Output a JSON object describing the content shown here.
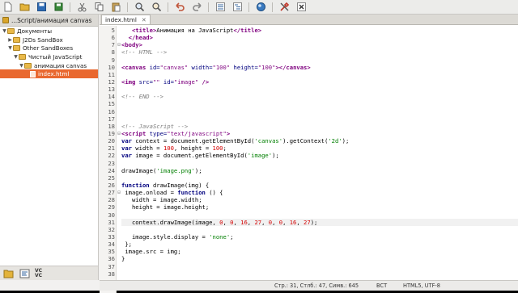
{
  "toolbar": {
    "buttons": [
      {
        "icon": "new-file-icon",
        "color": "#f0f0f0"
      },
      {
        "icon": "open-folder-icon",
        "color": "#e3b33a"
      },
      {
        "icon": "save-icon",
        "color": "#2e6bb5"
      },
      {
        "icon": "save-all-icon",
        "color": "#3a8a3a"
      },
      {
        "icon": "cut-icon",
        "color": "#666666"
      },
      {
        "icon": "copy-icon",
        "color": "#666666"
      },
      {
        "icon": "paste-icon",
        "color": "#c7a15a"
      },
      {
        "icon": "find-icon",
        "color": "#555555"
      },
      {
        "icon": "replace-icon",
        "color": "#555555"
      },
      {
        "icon": "undo-icon",
        "color": "#c0553a"
      },
      {
        "icon": "redo-icon",
        "color": "#888888"
      },
      {
        "icon": "list-icon",
        "color": "#3a6aa0"
      },
      {
        "icon": "outline-icon",
        "color": "#3a6aa0"
      },
      {
        "icon": "browser-icon",
        "color": "#3a7ac0"
      },
      {
        "icon": "tools-icon",
        "color": "#c0392b"
      },
      {
        "icon": "close-icon",
        "color": "#333333"
      }
    ]
  },
  "project": {
    "tab_label": "...Script/анимация canvas",
    "tree": [
      {
        "label": "Документы",
        "kind": "folder",
        "depth": 0,
        "expanded": true
      },
      {
        "label": "J2Ds SandBox",
        "kind": "folder",
        "depth": 1,
        "expanded": false
      },
      {
        "label": "Other SandBoxes",
        "kind": "folder",
        "depth": 1,
        "expanded": true
      },
      {
        "label": "Чистый JavaScript",
        "kind": "folder",
        "depth": 2,
        "expanded": true
      },
      {
        "label": "анимация canvas",
        "kind": "folder",
        "depth": 3,
        "expanded": true
      },
      {
        "label": "index.html",
        "kind": "file",
        "depth": 4,
        "selected": true
      }
    ]
  },
  "bottom_tools": [
    {
      "icon": "file-browser-icon"
    },
    {
      "icon": "symbols-icon"
    },
    {
      "icon": "version-control-icon",
      "label": "VC VC"
    }
  ],
  "editor": {
    "tab_label": "index.html",
    "tab_close": "✕",
    "current_line": 31,
    "lines": [
      {
        "n": "5",
        "fold": "",
        "tokens": [
          [
            "p",
            "   "
          ],
          [
            "t",
            "<title>"
          ],
          [
            "p",
            "Анимация на JavaScript"
          ],
          [
            "t",
            "</title>"
          ]
        ]
      },
      {
        "n": "6",
        "fold": "",
        "tokens": [
          [
            "p",
            "  "
          ],
          [
            "t",
            "</head>"
          ]
        ]
      },
      {
        "n": "7",
        "fold": "⊟",
        "tokens": [
          [
            "t",
            "<body>"
          ]
        ]
      },
      {
        "n": "8",
        "fold": "",
        "tokens": [
          [
            "c",
            "<!-- HTML -->"
          ]
        ]
      },
      {
        "n": "9",
        "fold": "",
        "tokens": []
      },
      {
        "n": "10",
        "fold": "",
        "tokens": [
          [
            "t",
            "<canvas "
          ],
          [
            "a",
            "id="
          ],
          [
            "s",
            "\"canvas\""
          ],
          [
            "a",
            " width="
          ],
          [
            "s",
            "\"100\""
          ],
          [
            "a",
            " height="
          ],
          [
            "s",
            "\"100\""
          ],
          [
            "t",
            "></canvas>"
          ]
        ]
      },
      {
        "n": "11",
        "fold": "",
        "tokens": []
      },
      {
        "n": "12",
        "fold": "",
        "tokens": [
          [
            "t",
            "<img "
          ],
          [
            "a",
            "src="
          ],
          [
            "s",
            "\"\""
          ],
          [
            "a",
            " id="
          ],
          [
            "s",
            "\"image\""
          ],
          [
            "t",
            " />"
          ]
        ]
      },
      {
        "n": "13",
        "fold": "",
        "tokens": []
      },
      {
        "n": "14",
        "fold": "",
        "tokens": [
          [
            "c",
            "<!-- END -->"
          ]
        ]
      },
      {
        "n": "15",
        "fold": "",
        "tokens": []
      },
      {
        "n": "16",
        "fold": "",
        "tokens": []
      },
      {
        "n": "17",
        "fold": "",
        "tokens": []
      },
      {
        "n": "18",
        "fold": "",
        "tokens": [
          [
            "c",
            "<!-- JavaScript -->"
          ]
        ]
      },
      {
        "n": "19",
        "fold": "⊟",
        "tokens": [
          [
            "t",
            "<script "
          ],
          [
            "a",
            "type="
          ],
          [
            "s",
            "\"text/javascript\""
          ],
          [
            "t",
            ">"
          ]
        ]
      },
      {
        "n": "20",
        "fold": "",
        "tokens": [
          [
            "k",
            "var"
          ],
          [
            "p",
            " context = document.getElementById("
          ],
          [
            "sq",
            "'canvas'"
          ],
          [
            "p",
            ").getContext("
          ],
          [
            "sq",
            "'2d'"
          ],
          [
            "p",
            ");"
          ]
        ]
      },
      {
        "n": "21",
        "fold": "",
        "tokens": [
          [
            "k",
            "var"
          ],
          [
            "p",
            " width = "
          ],
          [
            "n",
            "100"
          ],
          [
            "p",
            ", height = "
          ],
          [
            "n",
            "100"
          ],
          [
            "p",
            ";"
          ]
        ]
      },
      {
        "n": "22",
        "fold": "",
        "tokens": [
          [
            "k",
            "var"
          ],
          [
            "p",
            " image = document.getElementById("
          ],
          [
            "sq",
            "'image'"
          ],
          [
            "p",
            ");"
          ]
        ]
      },
      {
        "n": "23",
        "fold": "",
        "tokens": []
      },
      {
        "n": "24",
        "fold": "",
        "tokens": [
          [
            "p",
            "drawImage("
          ],
          [
            "sq",
            "'image.png'"
          ],
          [
            "p",
            ");"
          ]
        ]
      },
      {
        "n": "25",
        "fold": "",
        "tokens": []
      },
      {
        "n": "26",
        "fold": "",
        "tokens": [
          [
            "k",
            "function"
          ],
          [
            "p",
            " drawImage(img) {"
          ]
        ]
      },
      {
        "n": "27",
        "fold": "⊟",
        "tokens": [
          [
            "p",
            " image.onload = "
          ],
          [
            "k",
            "function"
          ],
          [
            "p",
            " () {"
          ]
        ]
      },
      {
        "n": "28",
        "fold": "",
        "tokens": [
          [
            "p",
            "   width = image.width;"
          ]
        ]
      },
      {
        "n": "29",
        "fold": "",
        "tokens": [
          [
            "p",
            "   height = image.height;"
          ]
        ]
      },
      {
        "n": "30",
        "fold": "",
        "tokens": []
      },
      {
        "n": "31",
        "fold": "",
        "tokens": [
          [
            "p",
            "   context.drawImage(image, "
          ],
          [
            "n",
            "0"
          ],
          [
            "p",
            ", "
          ],
          [
            "n",
            "0"
          ],
          [
            "p",
            ", "
          ],
          [
            "n",
            "16"
          ],
          [
            "p",
            ", "
          ],
          [
            "n",
            "27"
          ],
          [
            "p",
            ", "
          ],
          [
            "n",
            "0"
          ],
          [
            "p",
            ", "
          ],
          [
            "n",
            "0"
          ],
          [
            "p",
            ", "
          ],
          [
            "n",
            "16"
          ],
          [
            "p",
            ", "
          ],
          [
            "n",
            "27"
          ],
          [
            "p",
            ");"
          ]
        ]
      },
      {
        "n": "32",
        "fold": "",
        "tokens": []
      },
      {
        "n": "33",
        "fold": "",
        "tokens": [
          [
            "p",
            "   image.style.display = "
          ],
          [
            "sq",
            "'none'"
          ],
          [
            "p",
            ";"
          ]
        ]
      },
      {
        "n": "34",
        "fold": "",
        "tokens": [
          [
            "p",
            " };"
          ]
        ]
      },
      {
        "n": "35",
        "fold": "",
        "tokens": [
          [
            "p",
            " image.src = img;"
          ]
        ]
      },
      {
        "n": "36",
        "fold": "",
        "tokens": [
          [
            "p",
            "}"
          ]
        ]
      },
      {
        "n": "37",
        "fold": "",
        "tokens": []
      },
      {
        "n": "38",
        "fold": "",
        "tokens": []
      }
    ]
  },
  "statusbar": {
    "position": "Стр.: 31, Стлб.: 47, Симв.: 645",
    "mode": "ВСТ",
    "encoding": "HTML5, UTF-8"
  }
}
